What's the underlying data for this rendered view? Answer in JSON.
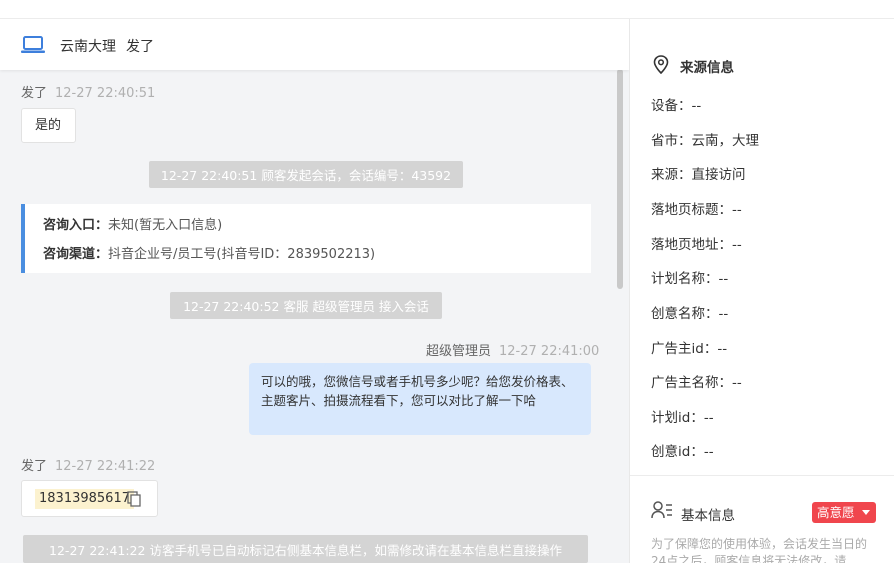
{
  "chat": {
    "header": {
      "location": "云南大理",
      "name": "发了"
    },
    "messages": {
      "m1": {
        "sender": "发了",
        "time": "12-27 22:40:51",
        "text": "是的"
      },
      "sys1": "12-27 22:40:51 顾客发起会话，会话编号：43592",
      "info": {
        "entry_label": "咨询入口：",
        "entry_value": "未知(暂无入口信息)",
        "channel_label": "咨询渠道：",
        "channel_value": "抖音企业号/员工号(抖音号ID：2839502213)"
      },
      "sys2": "12-27 22:40:52 客服 超级管理员 接入会话",
      "m2": {
        "sender": "超级管理员",
        "time": "12-27 22:41:00",
        "text": "可以的哦，您微信号或者手机号多少呢？给您发价格表、主题客片、拍摄流程看下，您可以对比了解一下哈"
      },
      "m3": {
        "sender": "发了",
        "time": "12-27 22:41:22",
        "phone": "18313985617"
      },
      "sys3": "12-27 22:41:22 访客手机号已自动标记右侧基本信息栏，如需修改请在基本信息栏直接操作"
    }
  },
  "side": {
    "source_title": "来源信息",
    "fields": [
      "设备：--",
      "省市：云南，大理",
      "来源：直接访问",
      "落地页标题：--",
      "落地页地址：--",
      "计划名称：--",
      "创意名称：--",
      "广告主id：--",
      "广告主名称：--",
      "计划id：--",
      "创意id：--"
    ],
    "basic_title": "基本信息",
    "intent_tag": "高意愿",
    "note": "为了保障您的使用体验，会话发生当日的24点之后，顾客信息将无法修改，请"
  },
  "colors": {
    "accent_blue": "#4a8ee0",
    "tag_red": "#f0464d",
    "bubble_blue": "#d8e8fd",
    "system_gray": "#d4d4d4"
  },
  "icons": [
    "laptop-icon",
    "location-pin-icon",
    "copy-icon",
    "person-list-icon",
    "caret-down-icon"
  ]
}
